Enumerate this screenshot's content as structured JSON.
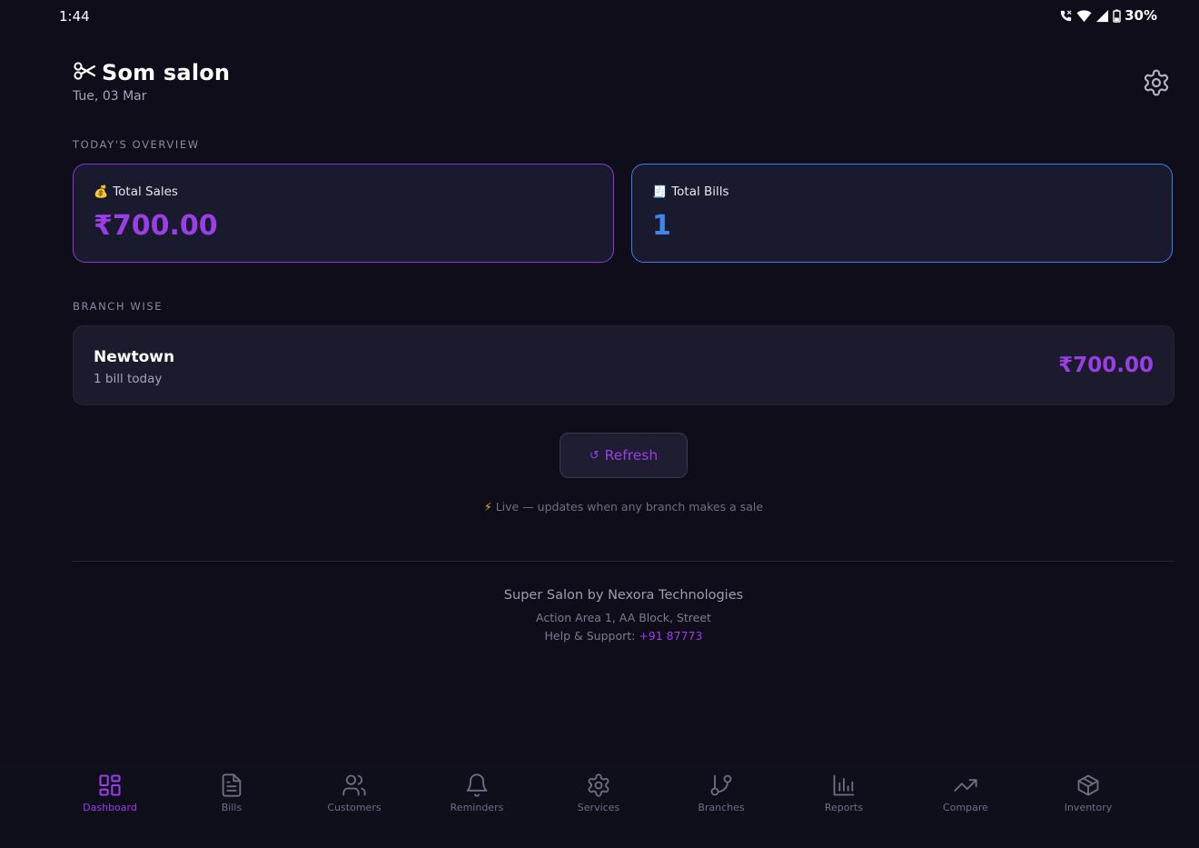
{
  "status_bar": {
    "time": "1:44",
    "battery": "30%"
  },
  "header": {
    "title": "Som salon",
    "date": "Tue, 03 Mar",
    "logo_icon": "scissors-icon",
    "settings_icon": "gear-icon"
  },
  "overview": {
    "section_label": "TODAY'S OVERVIEW",
    "total_sales": {
      "emoji": "💰",
      "label": "Total Sales",
      "value": "₹700.00"
    },
    "total_bills": {
      "emoji": "🧾",
      "label": "Total Bills",
      "value": "1"
    }
  },
  "branch_wise": {
    "section_label": "BRANCH WISE",
    "branches": [
      {
        "name": "Newtown",
        "subtitle": "1 bill today",
        "amount": "₹700.00"
      }
    ]
  },
  "refresh": {
    "icon": "↺",
    "label": "Refresh"
  },
  "live_note": {
    "icon": "⚡",
    "text": "Live — updates when any branch makes a sale"
  },
  "footer": {
    "company": "Super Salon by Nexora Technologies",
    "address": "Action Area 1, AA Block, Street",
    "help_label": "Help & Support: ",
    "help_phone": "+91 87773"
  },
  "nav": [
    {
      "label": "Dashboard",
      "icon": "dashboard-icon",
      "active": true
    },
    {
      "label": "Bills",
      "icon": "bills-icon",
      "active": false
    },
    {
      "label": "Customers",
      "icon": "customers-icon",
      "active": false
    },
    {
      "label": "Reminders",
      "icon": "bell-icon",
      "active": false
    },
    {
      "label": "Services",
      "icon": "gear-icon",
      "active": false
    },
    {
      "label": "Branches",
      "icon": "branch-icon",
      "active": false
    },
    {
      "label": "Reports",
      "icon": "bar-chart-icon",
      "active": false
    },
    {
      "label": "Compare",
      "icon": "trend-icon",
      "active": false
    },
    {
      "label": "Inventory",
      "icon": "box-icon",
      "active": false
    }
  ],
  "colors": {
    "background": "#0e0d19",
    "accent_purple": "#9a3fe6",
    "accent_blue": "#3f86ea",
    "card": "#1a1a2e"
  }
}
